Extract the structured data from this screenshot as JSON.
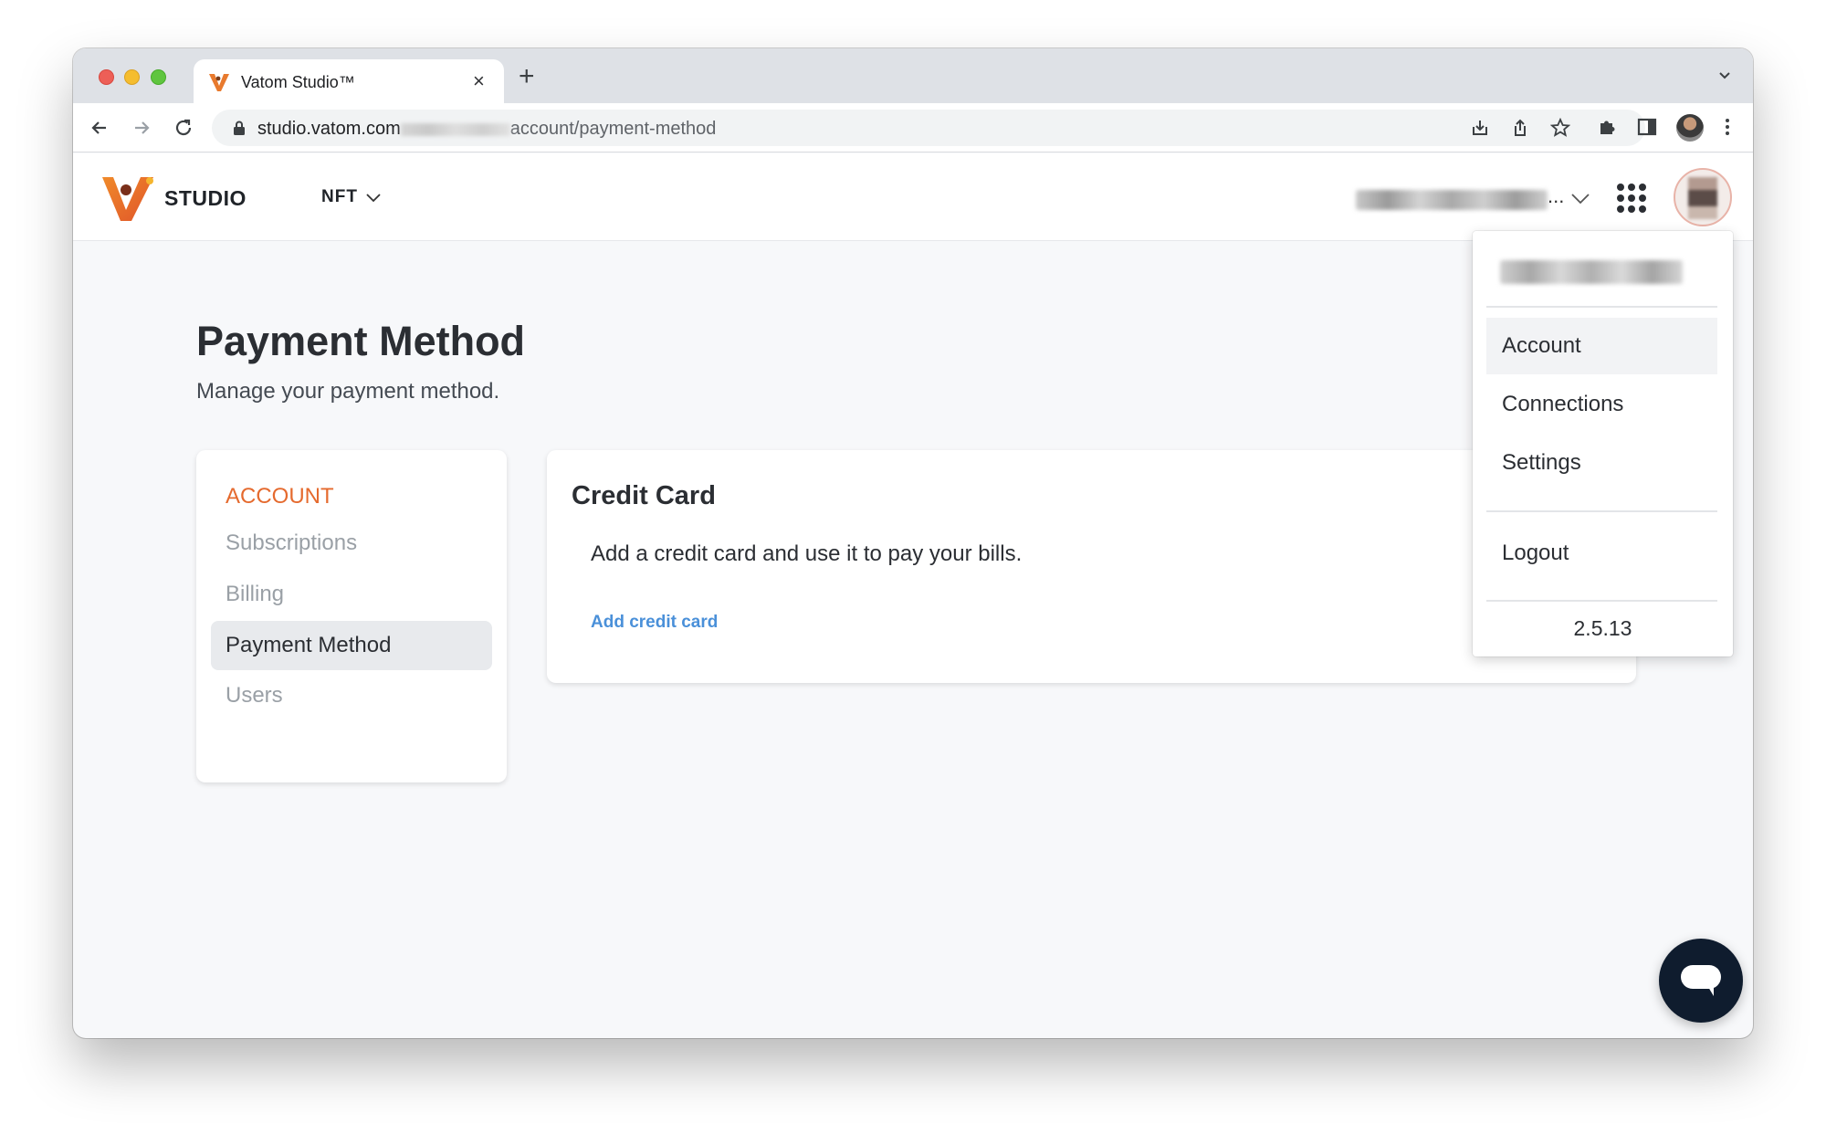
{
  "browser": {
    "tab_title": "Vatom Studio™",
    "tab_close": "×",
    "new_tab": "+",
    "url_host": "studio.vatom.com",
    "url_path": "account/payment-method"
  },
  "header": {
    "brand": "STUDIO",
    "nft_menu": "NFT",
    "user_ellipsis": "..."
  },
  "page": {
    "title": "Payment Method",
    "subtitle": "Manage your payment method."
  },
  "sidebar": {
    "heading": "ACCOUNT",
    "items": [
      {
        "label": "Subscriptions"
      },
      {
        "label": "Billing"
      },
      {
        "label": "Payment Method"
      },
      {
        "label": "Users"
      }
    ]
  },
  "credit_card": {
    "title": "Credit Card",
    "description": "Add a credit card and use it to pay your bills.",
    "add_link": "Add credit card"
  },
  "dropdown": {
    "items": [
      {
        "label": "Account"
      },
      {
        "label": "Connections"
      },
      {
        "label": "Settings"
      }
    ],
    "logout": "Logout",
    "version": "2.5.13"
  },
  "colors": {
    "accent_orange": "#e56a2e",
    "link_blue": "#4a90d9",
    "chat_bg": "#0f1c2e"
  }
}
